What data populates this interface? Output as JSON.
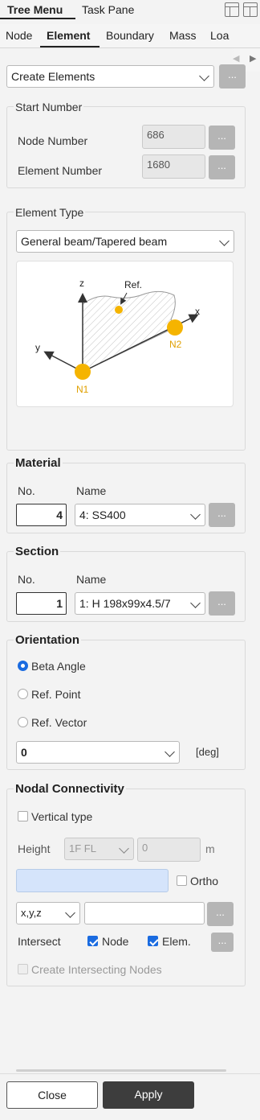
{
  "top_tabs": {
    "tree_menu": "Tree Menu",
    "task_pane": "Task Pane"
  },
  "sub_tabs": [
    "Node",
    "Element",
    "Boundary",
    "Mass",
    "Loa"
  ],
  "command": {
    "selected": "Create Elements",
    "more": "..."
  },
  "start_number": {
    "title": "Start Number",
    "node_label": "Node Number",
    "node_value": "686",
    "element_label": "Element Number",
    "element_value": "1680",
    "more": "..."
  },
  "element_type": {
    "title": "Element Type",
    "selected": "General beam/Tapered beam",
    "diagram": {
      "z": "z",
      "x": "x",
      "y": "y",
      "ref": "Ref.",
      "n1": "N1",
      "n2": "N2"
    }
  },
  "material": {
    "title": "Material",
    "no_label": "No.",
    "name_label": "Name",
    "no": "4",
    "name": "4: SS400",
    "more": "..."
  },
  "section": {
    "title": "Section",
    "no_label": "No.",
    "name_label": "Name",
    "no": "1",
    "name": "1: H 198x99x4.5/7",
    "more": "..."
  },
  "orientation": {
    "title": "Orientation",
    "options": [
      "Beta Angle",
      "Ref. Point",
      "Ref. Vector"
    ],
    "selected_index": 0,
    "angle": "0",
    "unit": "[deg]"
  },
  "nodal": {
    "title": "Nodal Connectivity",
    "vertical_type": "Vertical type",
    "height_label": "Height",
    "height_level": "1F FL",
    "height_value": "0",
    "height_unit": "m",
    "ortho": "Ortho",
    "coord_mode": "x,y,z",
    "coord_value": "",
    "more": "...",
    "intersect_label": "Intersect",
    "node": "Node",
    "elem": "Elem.",
    "create_intersecting": "Create Intersecting Nodes"
  },
  "footer": {
    "close": "Close",
    "apply": "Apply"
  },
  "colors": {
    "accent": "#1a6be0",
    "node_yellow": "#f5b400",
    "apply_bg": "#3d3d3d"
  }
}
